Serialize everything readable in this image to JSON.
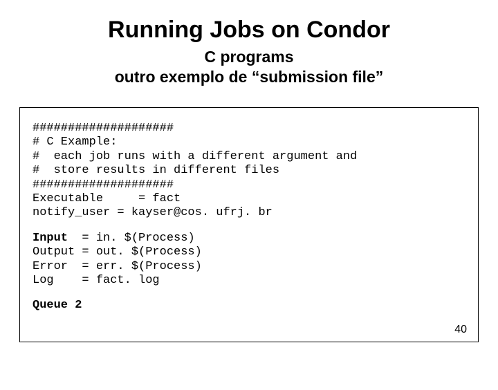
{
  "title": "Running Jobs on Condor",
  "subtitle1": "C programs",
  "subtitle2": "outro exemplo de “submission file”",
  "code": {
    "block1": "####################\n# C Example:\n#  each job runs with a different argument and\n#  store results in different files\n####################\nExecutable     = fact\nnotify_user = kayser@cos. ufrj. br",
    "line_input_label": "Input",
    "line_input_rest": "  = in. $(Process)",
    "block2": "Output = out. $(Process)\nError  = err. $(Process)\nLog    = fact. log",
    "queue_label": "Queue 2"
  },
  "page_number": "40"
}
